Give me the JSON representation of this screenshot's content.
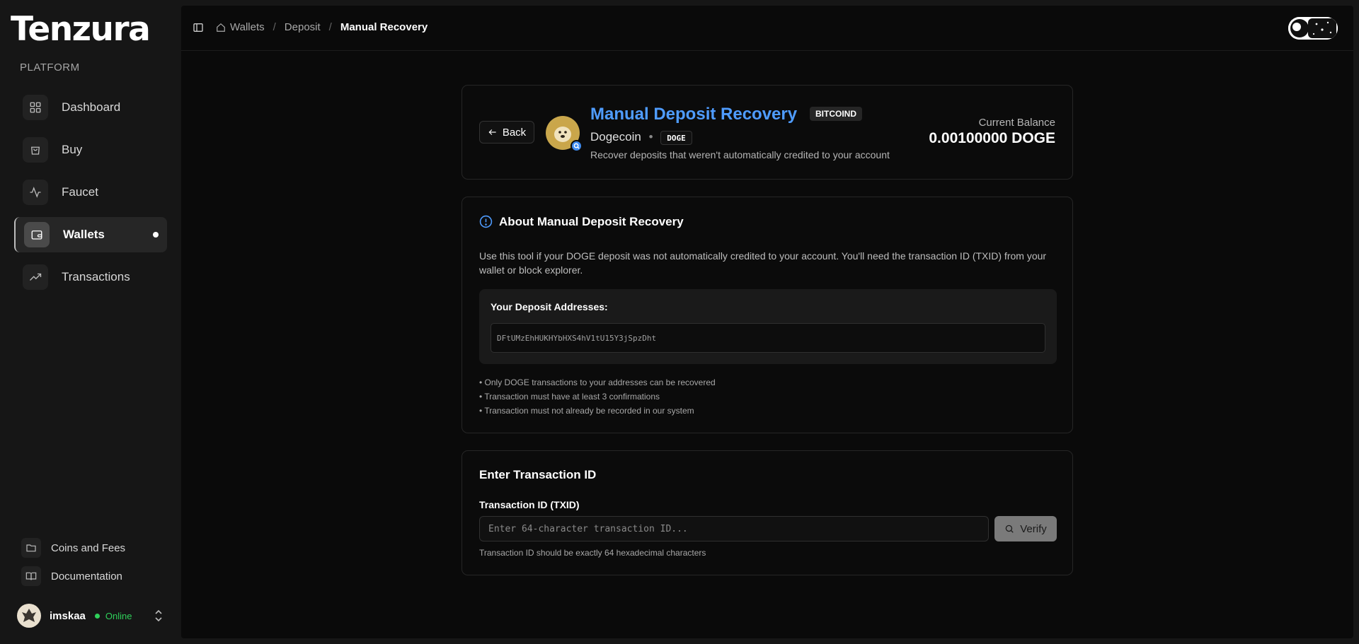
{
  "brand": {
    "name": "Tenzura"
  },
  "sidebar": {
    "section_label": "PLATFORM",
    "items": [
      {
        "label": "Dashboard",
        "icon": "grid-icon",
        "active": false
      },
      {
        "label": "Buy",
        "icon": "shopping-bag-icon",
        "active": false
      },
      {
        "label": "Faucet",
        "icon": "activity-icon",
        "active": false
      },
      {
        "label": "Wallets",
        "icon": "wallet-icon",
        "active": true
      },
      {
        "label": "Transactions",
        "icon": "trending-up-icon",
        "active": false
      }
    ],
    "footer_items": [
      {
        "label": "Coins and Fees",
        "icon": "folder-icon"
      },
      {
        "label": "Documentation",
        "icon": "book-open-icon"
      }
    ],
    "user": {
      "name": "imskaa",
      "status": "Online"
    }
  },
  "breadcrumb": {
    "items": [
      "Wallets",
      "Deposit"
    ],
    "current": "Manual Recovery"
  },
  "header_card": {
    "back_label": "Back",
    "title": "Manual Deposit Recovery",
    "network_tag": "BITCOIND",
    "coin_name": "Dogecoin",
    "coin_symbol": "DOGE",
    "subtitle": "Recover deposits that weren't automatically credited to your account",
    "balance_label": "Current Balance",
    "balance_value": "0.00100000 DOGE"
  },
  "about_card": {
    "title": "About Manual Deposit Recovery",
    "description": "Use this tool if your DOGE deposit was not automatically credited to your account. You'll need the transaction ID (TXID) from your wallet or block explorer.",
    "addresses_label": "Your Deposit Addresses:",
    "addresses": [
      "DFtUMzEhHUKHYbHXS4hV1tU15Y3jSpzDht"
    ],
    "rules": [
      "• Only DOGE transactions to your addresses can be recovered",
      "• Transaction must have at least 3 confirmations",
      "• Transaction must not already be recorded in our system"
    ]
  },
  "txid_card": {
    "title": "Enter Transaction ID",
    "field_label": "Transaction ID (TXID)",
    "placeholder": "Enter 64-character transaction ID...",
    "value": "",
    "verify_label": "Verify",
    "hint": "Transaction ID should be exactly 64 hexadecimal characters"
  },
  "colors": {
    "accent_blue": "#4f9cff",
    "online_green": "#2fd05a",
    "background": "#0a0a0a",
    "sidebar_bg": "#161616"
  }
}
